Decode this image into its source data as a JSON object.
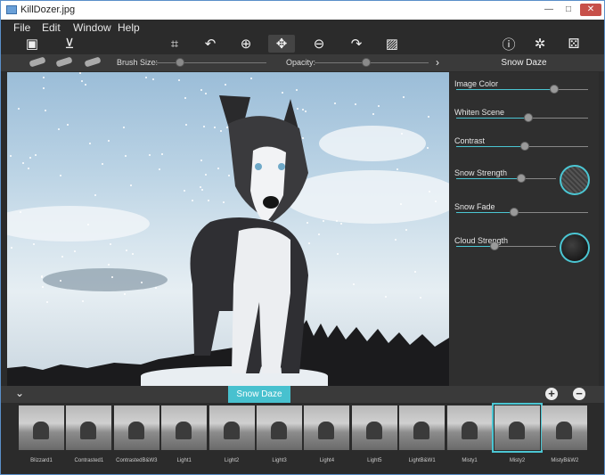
{
  "window": {
    "title": "KillDozer.jpg",
    "controls": {
      "minimize": "—",
      "maximize": "□",
      "close": "✕"
    }
  },
  "menu": [
    "File",
    "Edit",
    "Window",
    "Help"
  ],
  "toolbar": {
    "left": [
      {
        "name": "image-icon",
        "glyph": "▣"
      },
      {
        "name": "save-tray-icon",
        "glyph": "⊻"
      }
    ],
    "center": [
      {
        "name": "crop-icon",
        "glyph": "⌗"
      },
      {
        "name": "undo-icon",
        "glyph": "↶"
      },
      {
        "name": "zoom-in-icon",
        "glyph": "⊕"
      },
      {
        "name": "move-icon",
        "glyph": "✥"
      },
      {
        "name": "zoom-out-icon",
        "glyph": "⊖"
      },
      {
        "name": "redo-icon",
        "glyph": "↷"
      },
      {
        "name": "picture-icon",
        "glyph": "▨"
      }
    ],
    "right": [
      {
        "name": "info-icon",
        "glyph": "ⓘ"
      },
      {
        "name": "settings-icon",
        "glyph": "✲"
      },
      {
        "name": "random-icon",
        "glyph": "⚄"
      }
    ]
  },
  "options": {
    "brush_size_label": "Brush Size:",
    "brush_size": 0.0,
    "opacity_label": "Opacity:",
    "opacity": 0.45,
    "arrow": "›"
  },
  "panel": {
    "title": "Snow Daze",
    "params": [
      {
        "label": "Image Color",
        "value": 0.74,
        "texture": null
      },
      {
        "label": "Whiten Scene",
        "value": 0.55,
        "texture": null
      },
      {
        "label": "Contrast",
        "value": 0.52,
        "texture": null
      },
      {
        "label": "Snow Strength",
        "value": 0.65,
        "texture": "snow"
      },
      {
        "label": "Snow Fade",
        "value": 0.44,
        "texture": null
      },
      {
        "label": "Cloud Strength",
        "value": 0.38,
        "texture": "cloud"
      }
    ]
  },
  "bottom": {
    "collapse_glyph": "⌄",
    "preset_tab": "Snow Daze",
    "add_glyph": "+",
    "remove_glyph": "−"
  },
  "presets": [
    {
      "label": "Blizzard1",
      "selected": false
    },
    {
      "label": "Contrasted1",
      "selected": false
    },
    {
      "label": "ContrastedB&W3",
      "selected": false
    },
    {
      "label": "Light1",
      "selected": false
    },
    {
      "label": "Light2",
      "selected": false
    },
    {
      "label": "Light3",
      "selected": false
    },
    {
      "label": "Light4",
      "selected": false
    },
    {
      "label": "Light5",
      "selected": false
    },
    {
      "label": "LightB&W1",
      "selected": false
    },
    {
      "label": "Misty1",
      "selected": false
    },
    {
      "label": "Misty2",
      "selected": true
    },
    {
      "label": "MistyB&W2",
      "selected": false
    }
  ],
  "colors": {
    "accent": "#4bc6d3",
    "background": "#2b2b2b",
    "panel": "#2f2f2f",
    "bar": "#3a3a3a"
  }
}
